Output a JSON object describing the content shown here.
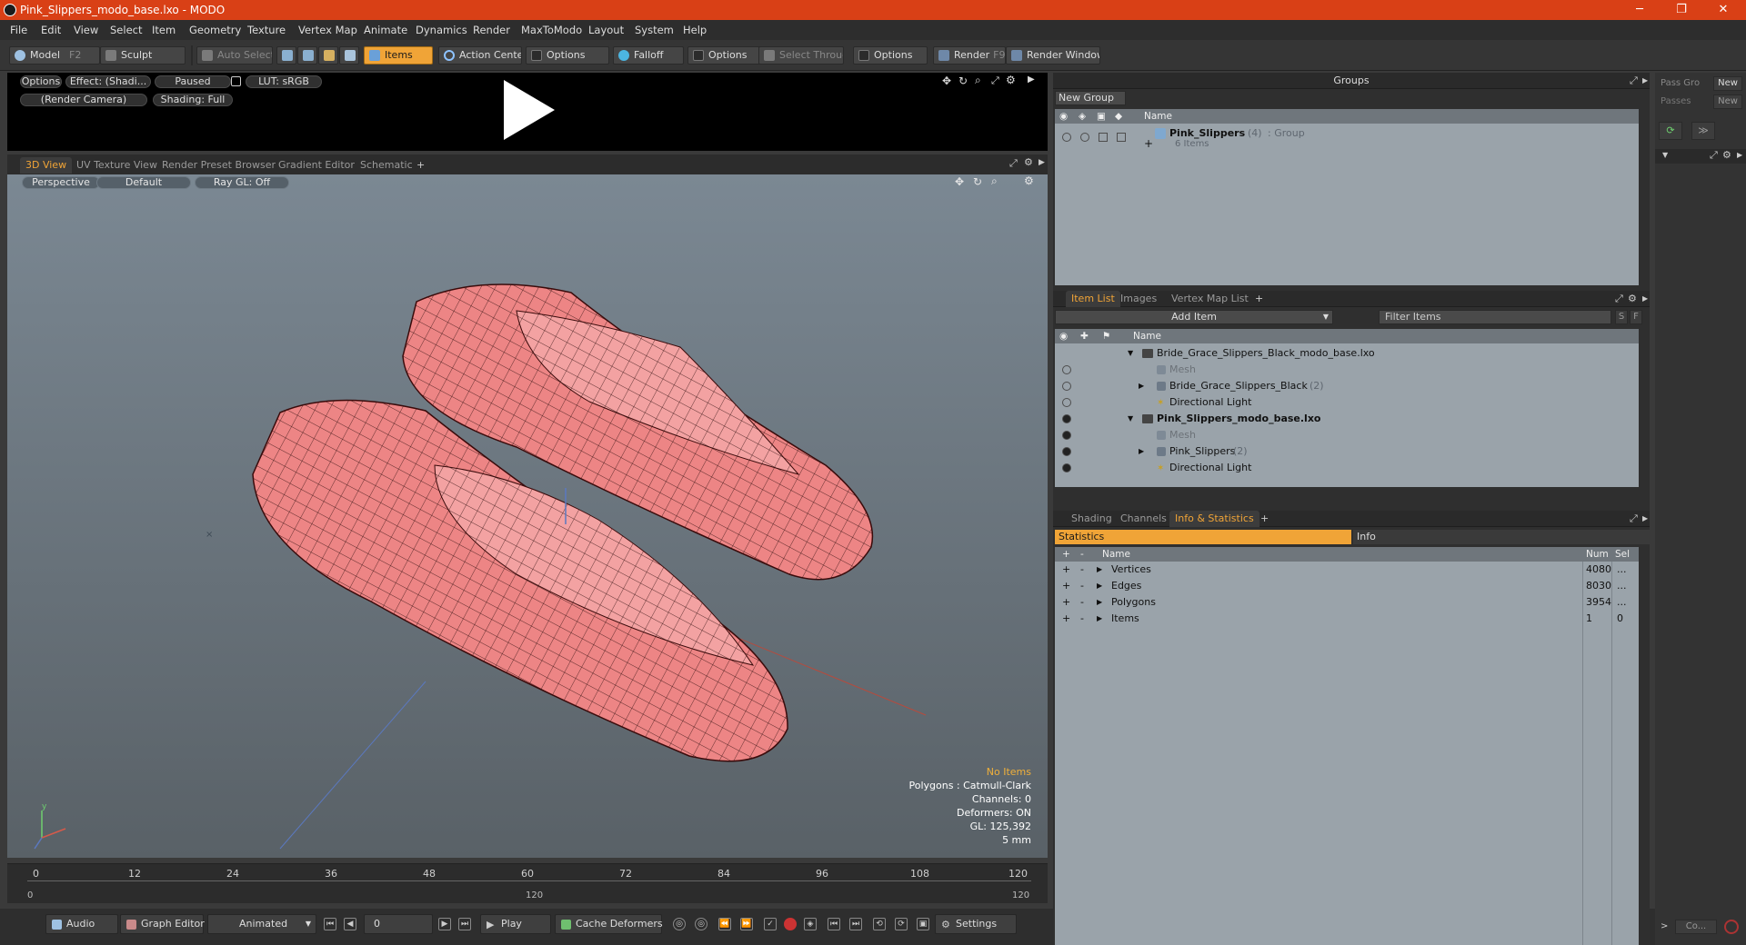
{
  "window": {
    "title": "Pink_Slippers_modo_base.lxo - MODO"
  },
  "menu": [
    "File",
    "Edit",
    "View",
    "Select",
    "Item",
    "Geometry",
    "Texture",
    "Vertex Map",
    "Animate",
    "Dynamics",
    "Render",
    "MaxToModo",
    "Layout",
    "System",
    "Help"
  ],
  "toolbar": {
    "model": "Model",
    "model_key": "F2",
    "sculpt": "Sculpt",
    "auto_select": "Auto Select",
    "items": "Items",
    "action_center": "Action Center",
    "options1": "Options",
    "falloff": "Falloff",
    "options2": "Options",
    "select_through": "Select Through",
    "options3": "Options",
    "render": "Render",
    "render_key": "F9",
    "render_window": "Render Window"
  },
  "preview": {
    "options": "Options",
    "effect": "Effect: (Shadi...",
    "paused": "Paused",
    "lut": "LUT: sRGB",
    "camera": "(Render Camera)",
    "shading": "Shading: Full"
  },
  "viewport_tabs": [
    "3D View",
    "UV Texture View",
    "Render Preset Browser",
    "Gradient Editor",
    "Schematic",
    "+"
  ],
  "viewport": {
    "perspective": "Perspective",
    "default": "Default",
    "raygl": "Ray GL: Off",
    "info": {
      "no_items": "No Items",
      "polygons": "Polygons : Catmull-Clark",
      "channels": "Channels: 0",
      "deformers": "Deformers: ON",
      "gl": "GL: 125,392",
      "units": "5 mm"
    }
  },
  "timeline": {
    "ticks": [
      "0",
      "12",
      "24",
      "36",
      "48",
      "60",
      "72",
      "84",
      "96",
      "108",
      "120"
    ],
    "bottom": [
      "0",
      "120",
      "120"
    ]
  },
  "bottom": {
    "audio": "Audio",
    "graph_editor": "Graph Editor",
    "animated": "Animated",
    "frame": "0",
    "play": "Play",
    "cache": "Cache Deformers",
    "settings": "Settings"
  },
  "groups": {
    "header": "Groups",
    "new_group": "New Group",
    "col_name": "Name",
    "item_name": "Pink_Slippers",
    "item_count": "(4)",
    "item_type": ": Group",
    "item_sub": "6 Items"
  },
  "items_panel": {
    "tabs": [
      "Item List",
      "Images",
      "Vertex Map List",
      "+"
    ],
    "add_item": "Add Item",
    "filter": "Filter Items",
    "s": "S",
    "f": "F",
    "col_name": "Name",
    "rows": [
      {
        "label": "Bride_Grace_Slippers_Black_modo_base.lxo"
      },
      {
        "label": "Mesh"
      },
      {
        "label": "Bride_Grace_Slippers_Black",
        "extra": "(2)"
      },
      {
        "label": "Directional Light"
      },
      {
        "label": "Pink_Slippers_modo_base.lxo"
      },
      {
        "label": "Mesh"
      },
      {
        "label": "Pink_Slippers",
        "extra": "(2)"
      },
      {
        "label": "Directional Light"
      }
    ]
  },
  "stats_panel": {
    "tabs": [
      "Shading",
      "Channels",
      "Info & Statistics",
      "+"
    ],
    "statistics": "Statistics",
    "info": "Info",
    "cols": {
      "name": "Name",
      "num": "Num",
      "sel": "Sel"
    },
    "rows": [
      {
        "name": "Vertices",
        "num": "4080",
        "sel": "..."
      },
      {
        "name": "Edges",
        "num": "8030",
        "sel": "..."
      },
      {
        "name": "Polygons",
        "num": "3954",
        "sel": "..."
      },
      {
        "name": "Items",
        "num": "1",
        "sel": "0"
      }
    ]
  },
  "far_right": {
    "pass_group": "Pass Gro",
    "passes": "Passes",
    "new": "New",
    "new2": "New",
    "bottom": "Co..."
  },
  "colors": {
    "accent": "#f0a437",
    "title": "#d94016",
    "mesh": "#f08a8a"
  }
}
